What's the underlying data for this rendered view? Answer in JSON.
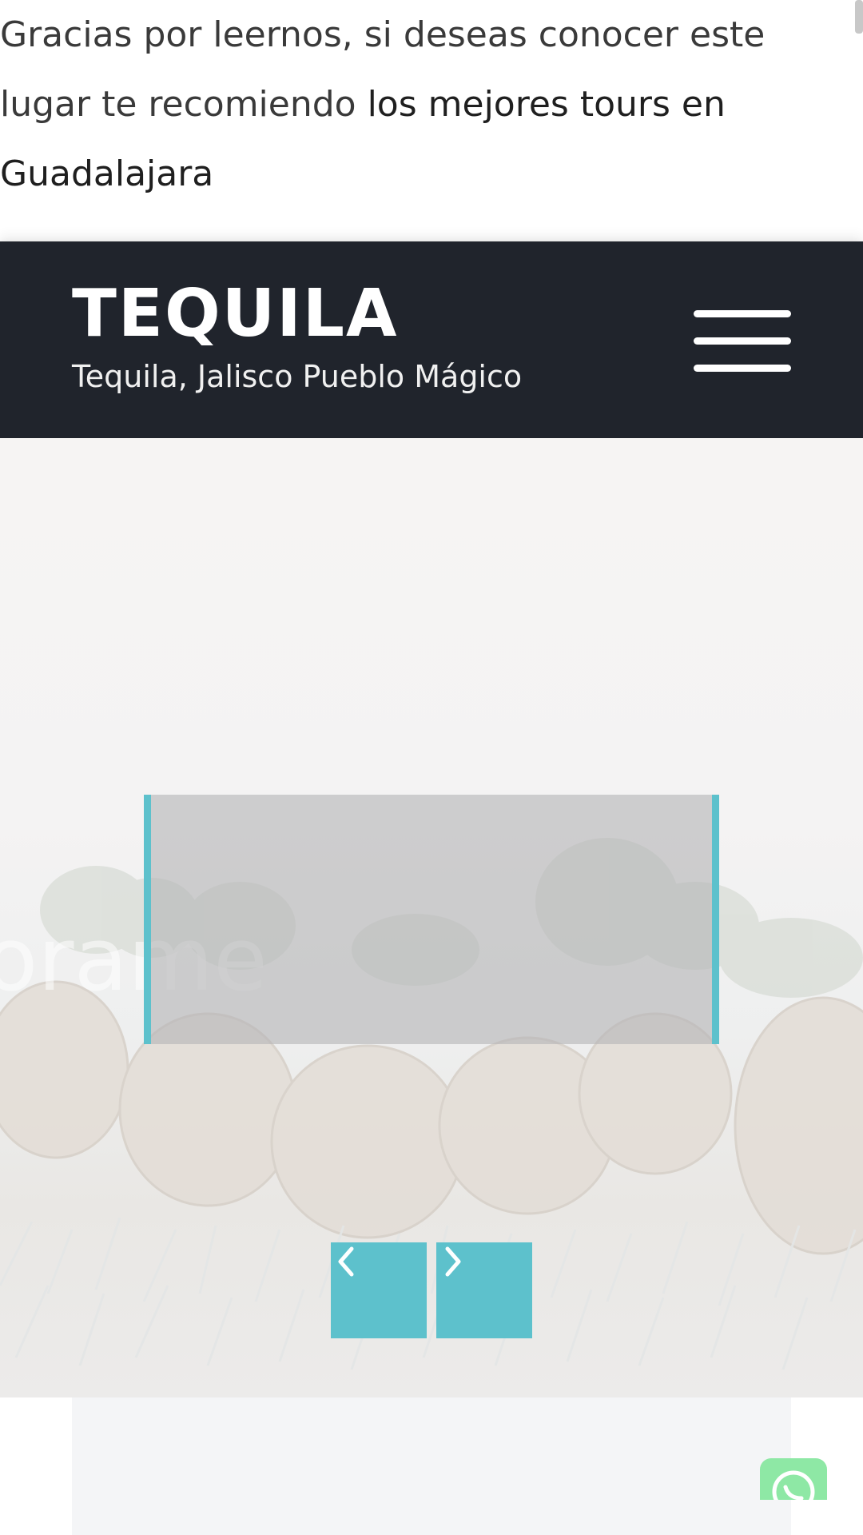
{
  "intro": {
    "text_before": "Gracias por leernos, si deseas conocer este lugar te recomiendo ",
    "link_text": " los mejores tours en Guadalajara"
  },
  "header": {
    "title": "TEQUILA",
    "subtitle": "Tequila, Jalisco Pueblo Mágico",
    "menu_icon": "hamburger-menu-icon",
    "background": "#20242c"
  },
  "slider": {
    "accent_color": "#5dc1cc",
    "prev_icon": "chevron-left-icon",
    "next_icon": "chevron-right-icon"
  },
  "floating": {
    "icon": "whatsapp-icon",
    "color": "#8ee8a5"
  }
}
